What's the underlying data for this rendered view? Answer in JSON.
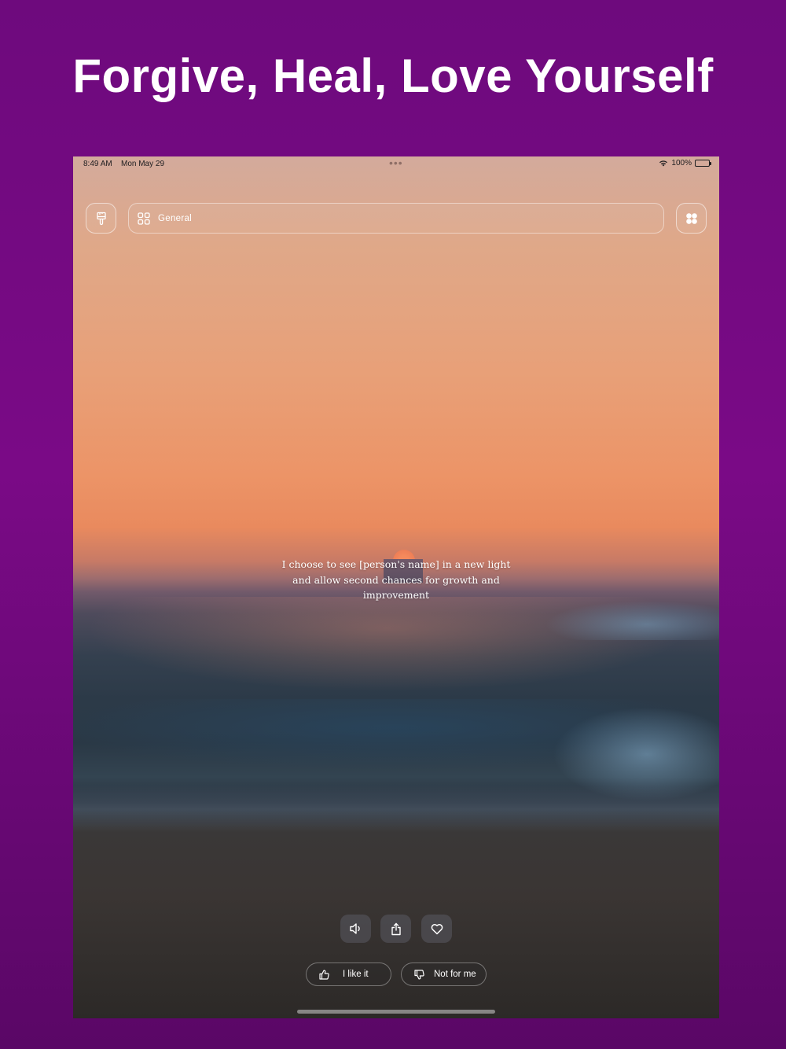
{
  "promo": {
    "headline": "Forgive, Heal, Love Yourself"
  },
  "status_bar": {
    "time": "8:49 AM",
    "date": "Mon May 29",
    "battery_percent": "100%",
    "icons": [
      "wifi-icon",
      "battery-icon"
    ]
  },
  "toolbar": {
    "left_icon": "paintbrush-icon",
    "category_icon": "grid-icon",
    "category_label": "General",
    "right_icon": "four-dots-grid-icon"
  },
  "affirmation": {
    "text": "I choose to see [person's name] in a new light and allow second chances for growth and improvement"
  },
  "actions": {
    "icons": [
      "speaker-icon",
      "share-icon",
      "heart-icon"
    ]
  },
  "feedback": {
    "like_label": "I like it",
    "dislike_label": "Not for me",
    "like_icon": "thumbs-up-icon",
    "dislike_icon": "thumbs-down-icon"
  },
  "colors": {
    "promo_background": "#7a0a86",
    "text": "#ffffff"
  }
}
